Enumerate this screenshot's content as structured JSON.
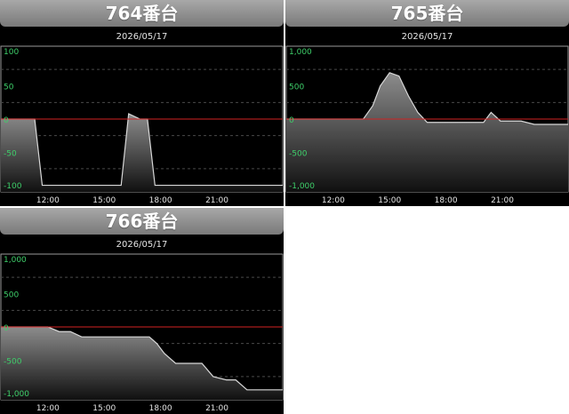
{
  "colors": {
    "panel_bg": "#000000",
    "plot_border": "#9a9a9a",
    "grid": "#4a4a4a",
    "zero_line": "#d22222",
    "series_line": "#d8d8d8",
    "area_top": "#8c8c8c",
    "area_bottom": "#101010",
    "y_label": "#3ecf6a",
    "x_label": "#e6e6e6"
  },
  "panels": [
    {
      "title": "764番台",
      "date": "2026/05/17",
      "chart_data": {
        "type": "area",
        "title": "764番台",
        "subtitle": "2026/05/17",
        "xlabel": "",
        "ylabel": "",
        "x_unit": "hours",
        "xlim": [
          9.5,
          24.5
        ],
        "ylim": [
          -110,
          110
        ],
        "y_ticks": [
          100,
          50,
          0,
          -50,
          -100
        ],
        "y_tick_labels": [
          "100",
          "50",
          "0",
          "-50",
          "-100"
        ],
        "x_ticks": [
          12,
          15,
          18,
          21
        ],
        "x_tick_labels": [
          "12:00",
          "15:00",
          "18:00",
          "21:00"
        ],
        "reference_line": 0,
        "grid": true,
        "legend": "none",
        "series": [
          {
            "x": [
              9.5,
              11.3,
              11.7,
              15.3,
              15.9,
              16.3,
              16.9,
              17.3,
              17.7,
              24.5
            ],
            "y": [
              0,
              0,
              -100,
              -100,
              -100,
              8,
              0,
              0,
              -100,
              -100
            ]
          }
        ]
      }
    },
    {
      "title": "765番台",
      "date": "2026/05/17",
      "chart_data": {
        "type": "area",
        "title": "765番台",
        "subtitle": "2026/05/17",
        "xlabel": "",
        "ylabel": "",
        "x_unit": "hours",
        "xlim": [
          9.5,
          24.5
        ],
        "ylim": [
          -1100,
          1100
        ],
        "y_ticks": [
          1000,
          500,
          0,
          -500,
          -1000
        ],
        "y_tick_labels": [
          "1,000",
          "500",
          "0",
          "-500",
          "-1,000"
        ],
        "x_ticks": [
          12,
          15,
          18,
          21
        ],
        "x_tick_labels": [
          "12:00",
          "15:00",
          "18:00",
          "21:00"
        ],
        "reference_line": 0,
        "grid": true,
        "legend": "none",
        "series": [
          {
            "x": [
              9.5,
              13.6,
              14.1,
              14.5,
              15.0,
              15.5,
              16.0,
              16.5,
              17.0,
              17.5,
              20.0,
              20.4,
              20.9,
              21.5,
              22.0,
              22.7,
              24.5
            ],
            "y": [
              0,
              0,
              200,
              500,
              700,
              650,
              350,
              100,
              -50,
              -50,
              -50,
              100,
              -30,
              -30,
              -30,
              -80,
              -80
            ]
          }
        ]
      }
    },
    {
      "title": "766番台",
      "date": "2026/05/17",
      "chart_data": {
        "type": "area",
        "title": "766番台",
        "subtitle": "2026/05/17",
        "xlabel": "",
        "ylabel": "",
        "x_unit": "hours",
        "xlim": [
          9.5,
          24.5
        ],
        "ylim": [
          -1100,
          1100
        ],
        "y_ticks": [
          1000,
          500,
          0,
          -500,
          -1000
        ],
        "y_tick_labels": [
          "1,000",
          "500",
          "0",
          "-500",
          "-1,000"
        ],
        "x_ticks": [
          12,
          15,
          18,
          21
        ],
        "x_tick_labels": [
          "12:00",
          "15:00",
          "18:00",
          "21:00"
        ],
        "reference_line": 0,
        "grid": true,
        "legend": "none",
        "series": [
          {
            "x": [
              9.5,
              12.0,
              12.6,
              13.2,
              13.8,
              14.3,
              17.4,
              17.8,
              18.2,
              18.8,
              19.8,
              20.2,
              20.8,
              21.5,
              22.0,
              22.6,
              24.5
            ],
            "y": [
              0,
              0,
              -70,
              -70,
              -150,
              -150,
              -150,
              -250,
              -400,
              -550,
              -550,
              -550,
              -750,
              -800,
              -800,
              -950,
              -950
            ]
          }
        ]
      }
    }
  ]
}
